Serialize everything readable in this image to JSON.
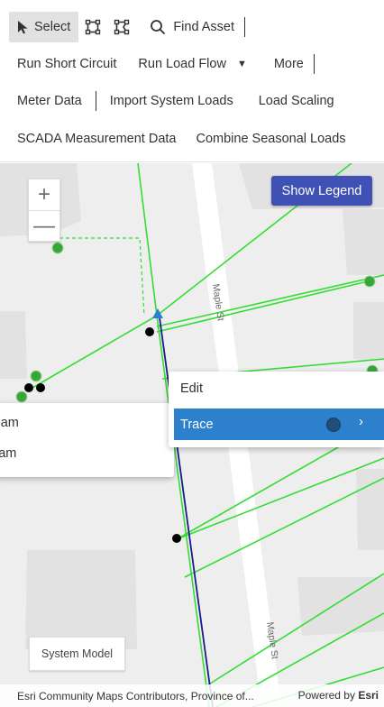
{
  "toolbar": {
    "row1": {
      "select_label": "Select",
      "find_asset_label": "Find Asset",
      "select_icon": "pointer-arrow-icon",
      "rect_select_icon": "rectangle-select-icon",
      "lasso_select_icon": "lasso-select-icon",
      "find_icon": "search-icon"
    },
    "row2": {
      "run_short_circuit": "Run Short Circuit",
      "run_load_flow": "Run Load Flow",
      "dropdown_icon": "caret-down-icon",
      "more": "More"
    },
    "row3": {
      "meter_data": "Meter Data",
      "import_system_loads": "Import System Loads",
      "load_scaling": "Load Scaling"
    },
    "row4": {
      "scada_measurement_data": "SCADA Measurement Data",
      "combine_seasonal_loads": "Combine Seasonal Loads"
    }
  },
  "map": {
    "zoom_in": "+",
    "zoom_out": "—",
    "show_legend": "Show Legend",
    "street_labels": [
      "Maple St",
      "Maple St"
    ],
    "context_menu": {
      "edit": "Edit",
      "trace": "Trace",
      "trace_chevron": "›"
    },
    "trace_submenu": {
      "item1": "Upstream",
      "item2": "Downstream"
    },
    "system_model": "System Model",
    "attribution_text": "Esri Community Maps Contributors, Province of...",
    "powered_by": "Powered by",
    "esri": "Esri"
  },
  "colors": {
    "line_green": "#33dd33",
    "line_blue": "#1a1a8c",
    "selected_marker": "#2d80cc",
    "legend_button": "#3f51b5",
    "trace_highlight": "#2d80cc"
  }
}
